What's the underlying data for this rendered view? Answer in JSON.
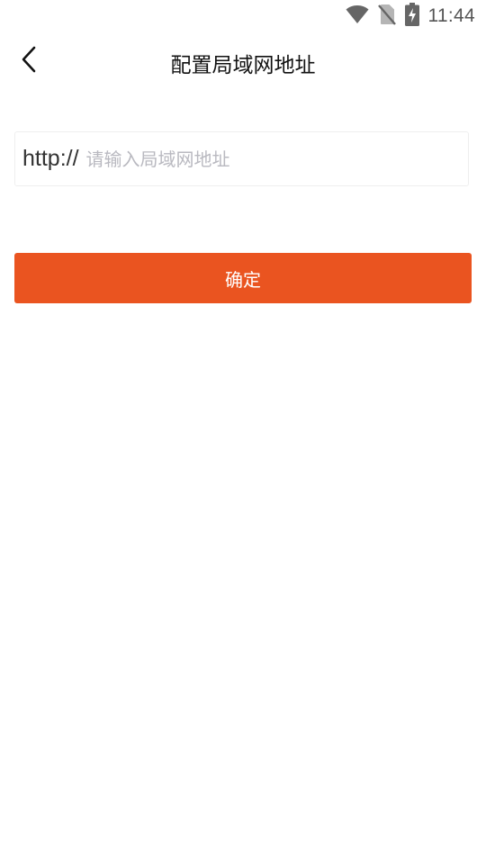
{
  "status_bar": {
    "time": "11:44",
    "icons": [
      "wifi-icon",
      "no-sim-icon",
      "battery-charging-icon"
    ]
  },
  "header": {
    "title": "配置局域网地址",
    "back_icon": "chevron-left-icon"
  },
  "address_form": {
    "prefix": "http://",
    "placeholder": "请输入局域网地址",
    "value": ""
  },
  "confirm_button": {
    "label": "确定"
  },
  "colors": {
    "accent": "#ea5420",
    "placeholder": "#b9b9c0",
    "border": "#eeeeee",
    "status_icon": "#666666"
  }
}
